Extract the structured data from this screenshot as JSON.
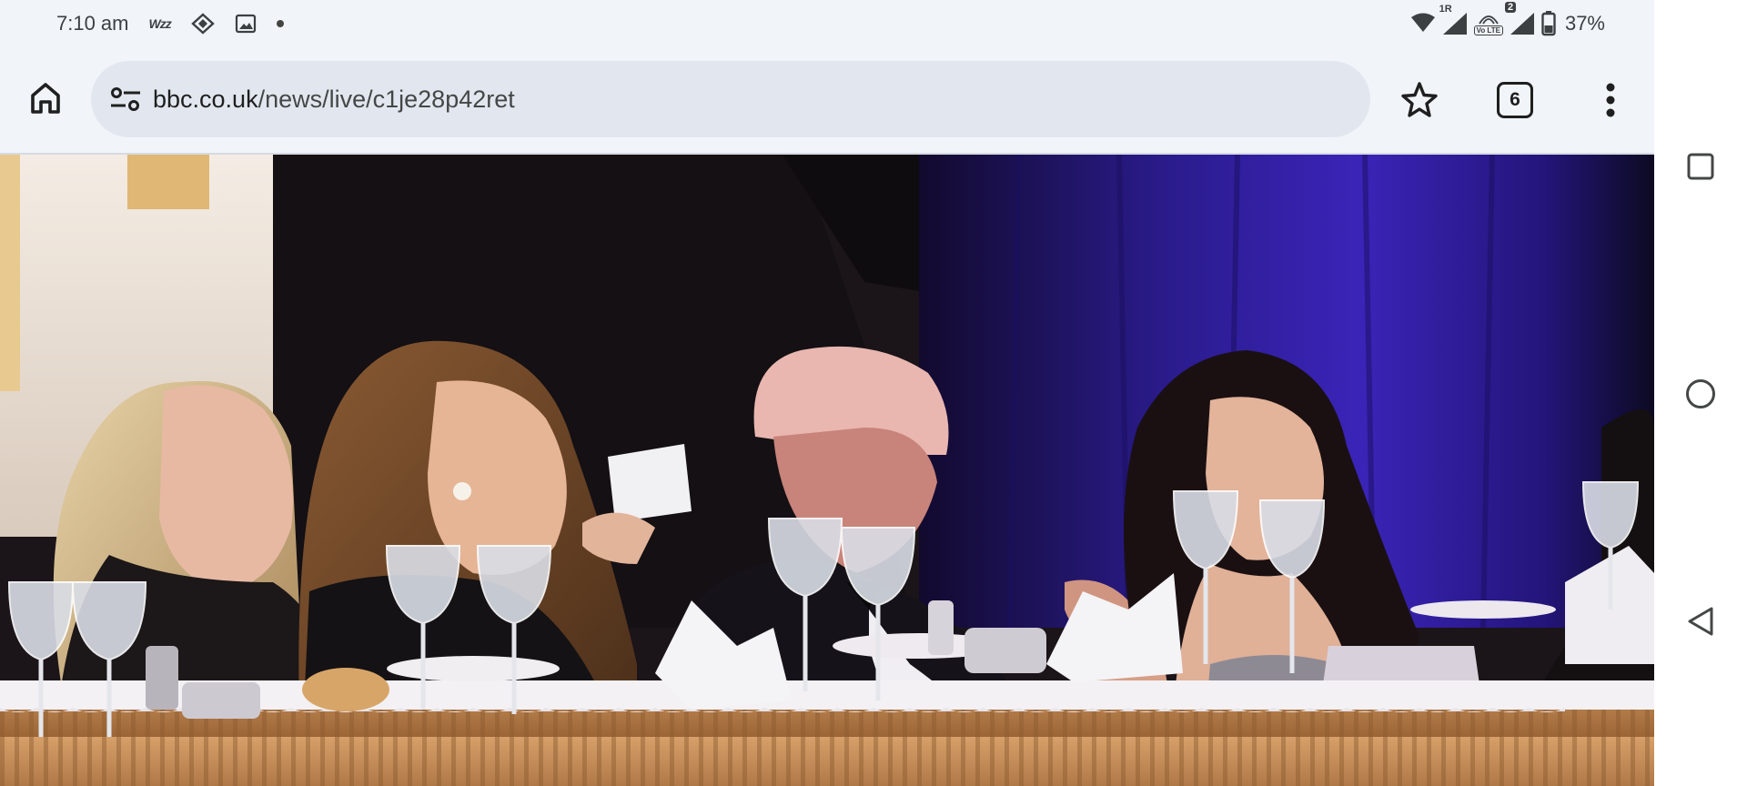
{
  "status_bar": {
    "time": "7:10 am",
    "wizz_label": "Wzz",
    "battery_percent": "37%",
    "network_badge": "1R",
    "volte_label": "Vo LTE",
    "sim_badge": "2",
    "left_icons": [
      "wizz-app-icon",
      "rocket-app-icon",
      "gallery-icon",
      "notification-dot"
    ],
    "right_icons": [
      "wifi-icon",
      "signal-icon",
      "volte-icon",
      "signal-icon",
      "battery-icon"
    ]
  },
  "toolbar": {
    "home_icon": "home-icon",
    "site_settings_icon": "tune-icon",
    "url_host": "bbc.co.uk",
    "url_path": "/news/live/c1je28p42ret",
    "bookmark_icon": "star-icon",
    "tab_count": "6",
    "menu_icon": "more-vert-icon"
  },
  "content": {
    "type": "video-frame",
    "description_icon": "photo"
  },
  "nav_bar": {
    "items": [
      "recents-button",
      "home-button",
      "back-button"
    ]
  },
  "colors": {
    "toolbar_bg": "#f1f4f9",
    "url_bar_bg": "#e2e7ef",
    "text_primary": "#1f1f1f",
    "curtain_blue": "#2a1a8a",
    "tablecloth": "#c8925a"
  }
}
